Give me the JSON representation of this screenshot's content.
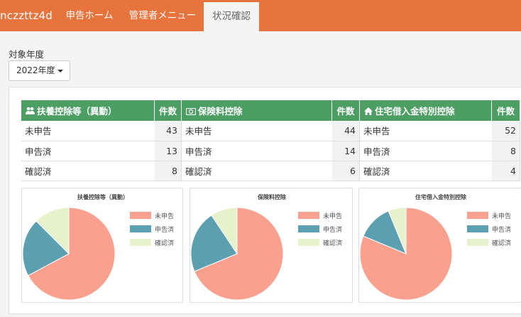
{
  "nav": {
    "brand": "nczzttz4d",
    "items": [
      {
        "label": "申告ホーム"
      },
      {
        "label": "管理者メニュー"
      },
      {
        "label": "状況確認"
      }
    ]
  },
  "filter": {
    "label": "対象年度",
    "selected": "2022年度"
  },
  "colors": {
    "nav": "#e8743d",
    "header": "#4c9e63",
    "unreported": "#f9a08e",
    "reported": "#5b9fb0",
    "confirmed": "#e6f2cc"
  },
  "tables": [
    {
      "title": "扶養控除等（異動）",
      "icon": "people-icon",
      "count_header": "件数",
      "rows": [
        {
          "status": "未申告",
          "count": 43
        },
        {
          "status": "申告済",
          "count": 13
        },
        {
          "status": "確認済",
          "count": 8
        }
      ]
    },
    {
      "title": "保険料控除",
      "icon": "money-icon",
      "count_header": "件数",
      "rows": [
        {
          "status": "未申告",
          "count": 44
        },
        {
          "status": "申告済",
          "count": 14
        },
        {
          "status": "確認済",
          "count": 6
        }
      ]
    },
    {
      "title": "住宅借入金特別控除",
      "icon": "home-icon",
      "count_header": "件数",
      "rows": [
        {
          "status": "未申告",
          "count": 52
        },
        {
          "status": "申告済",
          "count": 8
        },
        {
          "status": "確認済",
          "count": 4
        }
      ]
    }
  ],
  "chart_data": [
    {
      "type": "pie",
      "title": "扶養控除等（異動）",
      "categories": [
        "未申告",
        "申告済",
        "確認済"
      ],
      "values": [
        43,
        13,
        8
      ],
      "legend": "right"
    },
    {
      "type": "pie",
      "title": "保険料控除",
      "categories": [
        "未申告",
        "申告済",
        "確認済"
      ],
      "values": [
        44,
        14,
        6
      ],
      "legend": "right"
    },
    {
      "type": "pie",
      "title": "住宅借入金特別控除",
      "categories": [
        "未申告",
        "申告済",
        "確認済"
      ],
      "values": [
        52,
        8,
        4
      ],
      "legend": "right"
    }
  ]
}
